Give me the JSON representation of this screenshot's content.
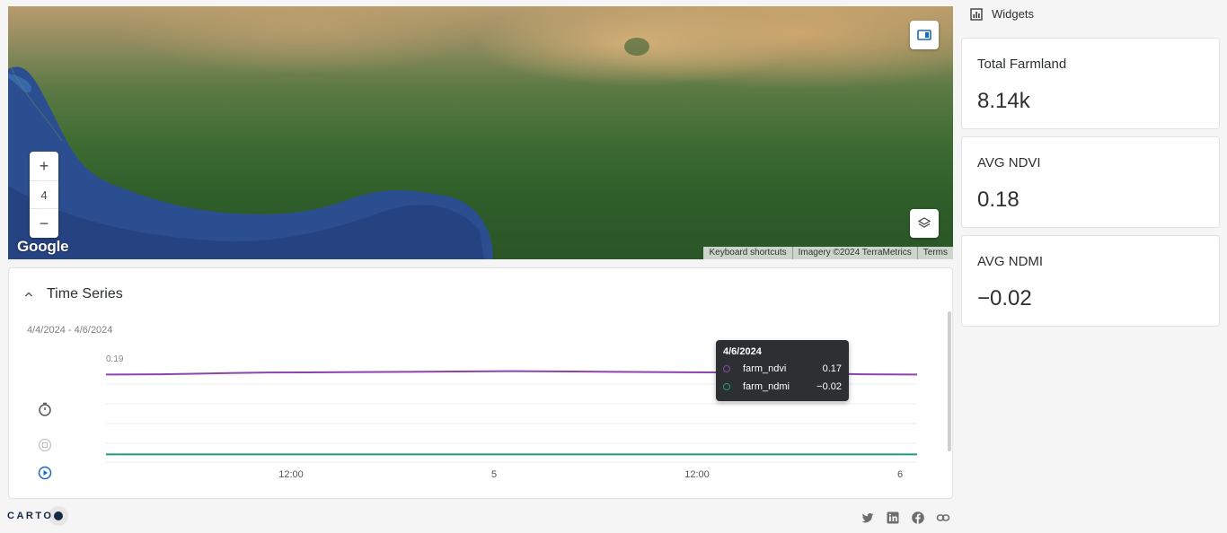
{
  "map": {
    "zoom_in_label": "+",
    "zoom_level": "4",
    "zoom_out_label": "−",
    "provider_logo": "Google",
    "attribution": [
      "Keyboard shortcuts",
      "Imagery ©2024 TerraMetrics",
      "Terms"
    ],
    "icons": {
      "panel_toggle": "sidebar-panel-icon",
      "layers": "layers-icon"
    }
  },
  "time_series": {
    "title": "Time Series",
    "range": "4/4/2024 - 4/6/2024",
    "controls": [
      "timer-icon",
      "stop-icon",
      "play-icon"
    ],
    "tooltip": {
      "date": "4/6/2024",
      "rows": [
        {
          "name": "farm_ndvi",
          "value": "0.17",
          "color": "#8e44ad"
        },
        {
          "name": "farm_ndmi",
          "value": "−0.02",
          "color": "#1e9e6e"
        }
      ]
    }
  },
  "chart_data": {
    "type": "line",
    "x_ticks": [
      "12:00",
      "5",
      "12:00",
      "6"
    ],
    "y_ticks": [
      "0.19"
    ],
    "series": [
      {
        "name": "farm_ndvi",
        "color": "#8e44ad",
        "x": [
          0,
          0.25,
          0.5,
          0.75,
          1.0
        ],
        "values": [
          0.17,
          0.175,
          0.178,
          0.175,
          0.17
        ]
      },
      {
        "name": "farm_ndmi",
        "color": "#1e9e6e",
        "x": [
          0,
          0.25,
          0.5,
          0.75,
          1.0
        ],
        "values": [
          -0.02,
          -0.02,
          -0.02,
          -0.02,
          -0.02
        ]
      }
    ],
    "ylim": [
      -0.03,
      0.19
    ],
    "grid": true
  },
  "widgets": {
    "header": "Widgets",
    "cards": [
      {
        "title": "Total Farmland",
        "value": "8.14k"
      },
      {
        "title": "AVG NDVI",
        "value": "0.18"
      },
      {
        "title": "AVG NDMI",
        "value": "−0.02"
      }
    ]
  },
  "footer": {
    "brand": "CARTO",
    "social": [
      "twitter-icon",
      "linkedin-icon",
      "facebook-icon",
      "link-icon"
    ]
  }
}
